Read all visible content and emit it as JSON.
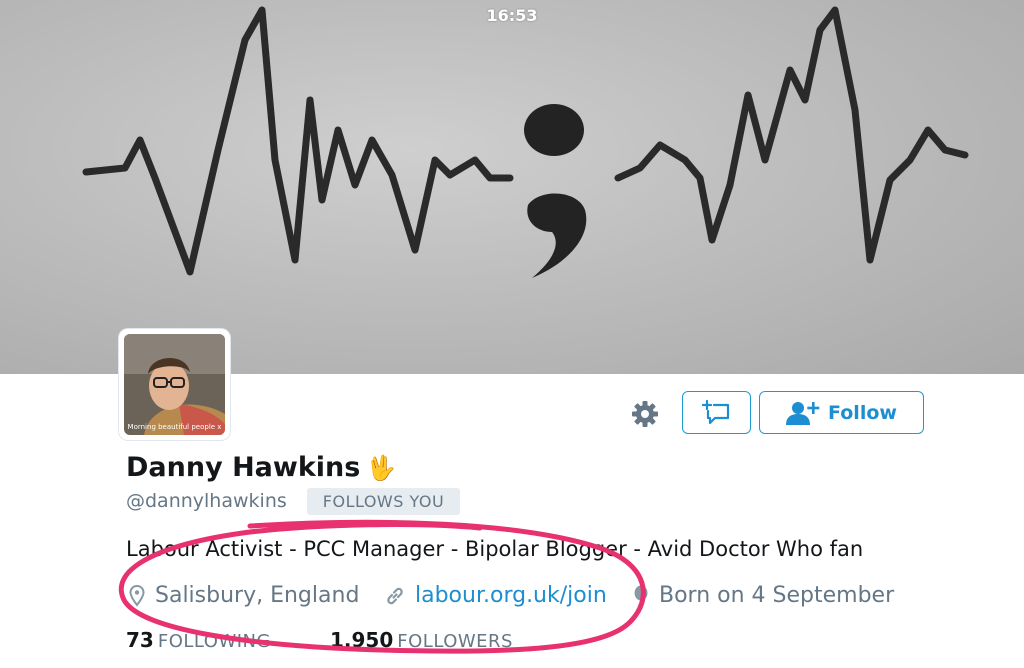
{
  "status_bar": {
    "time": "16:53"
  },
  "profile": {
    "display_name": "Danny Hawkins",
    "name_emoji": "🖖",
    "handle": "@dannylhawkins",
    "follows_you_badge": "FOLLOWS YOU",
    "avatar_caption": "Morning beautiful people x",
    "bio": "Labour Activist - PCC Manager - Bipolar Blogger - Avid Doctor Who fan",
    "location": "Salisbury, England",
    "website": "labour.org.uk/join",
    "birthday": "Born on 4 September"
  },
  "actions": {
    "follow_label": "Follow"
  },
  "stats": {
    "following_count": "73",
    "following_label": "FOLLOWING",
    "followers_count": "1,950",
    "followers_label": "FOLLOWERS"
  },
  "colors": {
    "accent": "#1d8ed1",
    "secondary_text": "#657786",
    "annotation": "#e8316f"
  },
  "icons": {
    "settings": "gear-icon",
    "direct_message": "message-plus-icon",
    "follow": "add-user-icon",
    "location": "location-pin-icon",
    "link": "link-icon",
    "birthday": "balloon-icon"
  }
}
